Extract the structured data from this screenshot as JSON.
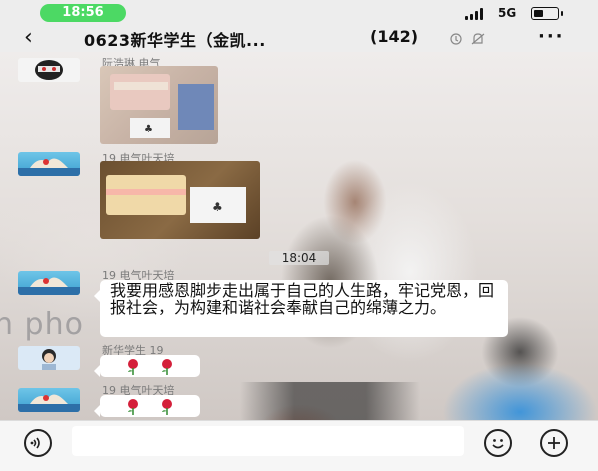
{
  "status_bar": {
    "time": "18:56",
    "network": "5G"
  },
  "nav": {
    "back_icon": "‹",
    "title": "0623新华学生（金凯...",
    "member_count": "(142)",
    "more_icon": "···"
  },
  "messages": [
    {
      "sender": "阮浩琳 电气",
      "type": "image"
    },
    {
      "sender": "19 电气叶天培",
      "type": "image"
    },
    {
      "sender": "19 电气叶天培",
      "type": "text",
      "text": "我要用感恩脚步走出属于自己的人生路，牢记党恩，回报社会，为构建和谐社会奉献自己的绵薄之力。"
    },
    {
      "sender": "新华学生 19",
      "type": "emoji",
      "emoji": "🌹 🌹"
    },
    {
      "sender": "19 电气叶天培",
      "type": "emoji",
      "emoji": "🌹 🌹"
    }
  ],
  "timestamp": "18:04",
  "wallpaper_text": "n pho",
  "input_bar": {
    "placeholder": "",
    "voice_icon": "voice-icon",
    "emoji_icon": "emoji-icon",
    "plus_icon": "plus-icon"
  },
  "colors": {
    "time_pill": "#4cd964",
    "bubble": "#ffffff",
    "bar_bg": "#ededed"
  }
}
